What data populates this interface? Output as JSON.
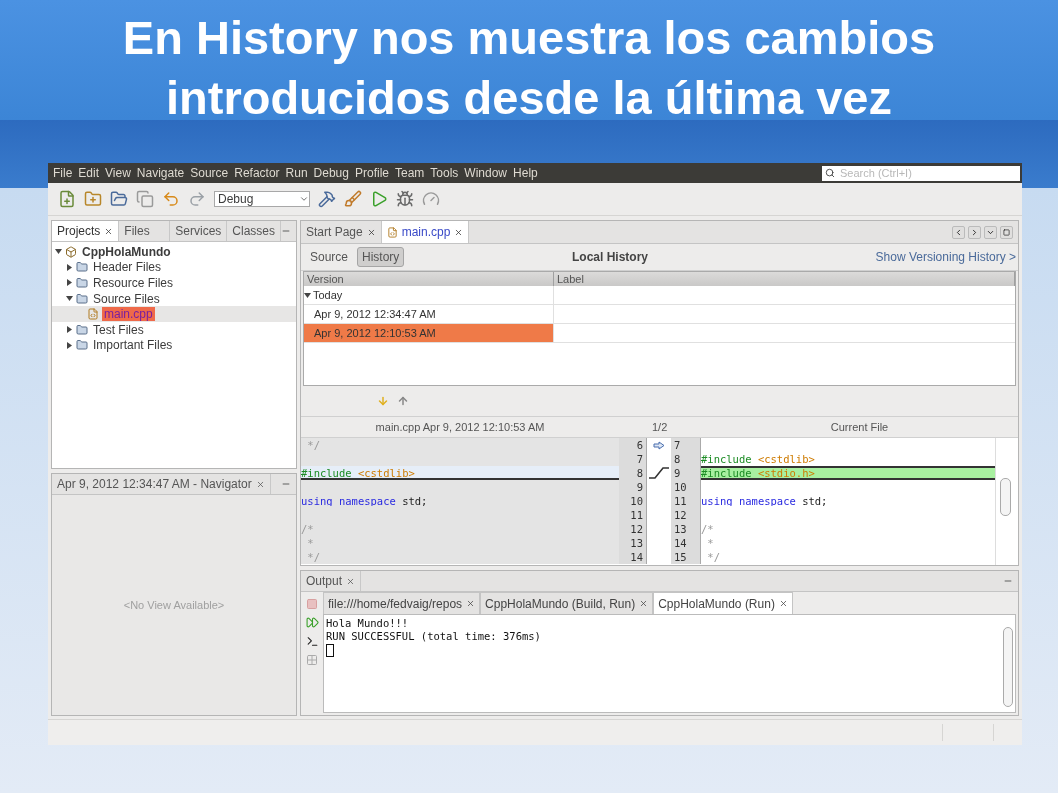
{
  "slide_title": "En History nos muestra los cambios introducidos desde la última vez",
  "menu": [
    "File",
    "Edit",
    "View",
    "Navigate",
    "Source",
    "Refactor",
    "Run",
    "Debug",
    "Profile",
    "Team",
    "Tools",
    "Window",
    "Help"
  ],
  "search": {
    "placeholder": "Search (Ctrl+I)"
  },
  "toolbar": {
    "configuration": "Debug"
  },
  "projects_panel": {
    "tabs": [
      {
        "label": "Projects",
        "selected": true,
        "closable": true
      },
      {
        "label": "Files",
        "selected": false,
        "closable": false
      },
      {
        "label": "Services",
        "selected": false,
        "closable": false
      },
      {
        "label": "Classes",
        "selected": false,
        "closable": false
      }
    ],
    "tree": [
      {
        "label": "CppHolaMundo",
        "kind": "project",
        "expanded": true,
        "selected": false,
        "children": [
          {
            "label": "Header Files",
            "kind": "folder",
            "expanded": false,
            "selected": false
          },
          {
            "label": "Resource Files",
            "kind": "folder",
            "expanded": false,
            "selected": false
          },
          {
            "label": "Source Files",
            "kind": "folder",
            "expanded": true,
            "selected": false,
            "children": [
              {
                "label": "main.cpp",
                "kind": "file",
                "selected": true
              }
            ]
          },
          {
            "label": "Test Files",
            "kind": "folder",
            "expanded": false,
            "selected": false
          },
          {
            "label": "Important Files",
            "kind": "folder",
            "expanded": false,
            "selected": false
          }
        ]
      }
    ]
  },
  "navigator": {
    "tab": "Apr 9, 2012 12:34:47 AM - Navigator",
    "empty_text": "<No View Available>"
  },
  "editor": {
    "tabs": [
      {
        "label": "Start Page",
        "selected": false
      },
      {
        "label": "main.cpp",
        "selected": true
      }
    ],
    "view_buttons": [
      {
        "label": "Source",
        "selected": false
      },
      {
        "label": "History",
        "selected": true
      }
    ],
    "title": "Local History",
    "link": "Show Versioning History >",
    "table": {
      "columns": [
        "Version",
        "Label"
      ],
      "rows": [
        {
          "version": "Today",
          "kind": "group",
          "expanded": true,
          "selected": false
        },
        {
          "version": "Apr 9, 2012 12:34:47 AM",
          "kind": "entry",
          "selected": false
        },
        {
          "version": "Apr 9, 2012 12:10:53 AM",
          "kind": "entry",
          "selected": true
        }
      ]
    },
    "diff": {
      "left_title": "main.cpp Apr 9, 2012 12:10:53 AM",
      "position": "1/2",
      "right_title": "Current File",
      "lines": [
        {
          "left_number": "6",
          "left": [
            {
              "kind": "comment",
              "text": " */"
            }
          ],
          "right_number": "7",
          "left_highlighted": false,
          "added": false,
          "current": true
        },
        {
          "left_number": "7",
          "right_number": "8",
          "right": [
            {
              "kind": "directive",
              "text": "#include"
            },
            {
              "kind": "header",
              "text": " <cstdlib>"
            }
          ],
          "left_highlighted": false,
          "added": false,
          "current": false
        },
        {
          "left_number": "8",
          "left": [
            {
              "kind": "directive",
              "text": "#include"
            },
            {
              "kind": "header",
              "text": " <cstdlib>"
            }
          ],
          "right_number": "9",
          "right": [
            {
              "kind": "directive",
              "text": "#include"
            },
            {
              "kind": "header",
              "text": " <stdio.h>"
            }
          ],
          "left_highlighted": true,
          "added": true,
          "current": false
        },
        {
          "left_number": "9",
          "right_number": "10",
          "left_highlighted": false,
          "added": false,
          "current": false
        },
        {
          "left_number": "10",
          "left": [
            {
              "kind": "keyword",
              "text": "using namespace"
            },
            {
              "kind": "plain",
              "text": " std;"
            }
          ],
          "right_number": "11",
          "right": [
            {
              "kind": "keyword",
              "text": "using namespace"
            },
            {
              "kind": "plain",
              "text": " std;"
            }
          ],
          "left_highlighted": false,
          "added": false,
          "current": false
        },
        {
          "left_number": "11",
          "right_number": "12",
          "left_highlighted": false,
          "added": false,
          "current": false
        },
        {
          "left_number": "12",
          "left": [
            {
              "kind": "comment",
              "text": "/*"
            }
          ],
          "right_number": "13",
          "right": [
            {
              "kind": "comment",
              "text": "/*"
            }
          ],
          "left_highlighted": false,
          "added": false,
          "current": false
        },
        {
          "left_number": "13",
          "left": [
            {
              "kind": "comment",
              "text": " *"
            }
          ],
          "right_number": "14",
          "right": [
            {
              "kind": "comment",
              "text": " *"
            }
          ],
          "left_highlighted": false,
          "added": false,
          "current": false
        },
        {
          "left_number": "14",
          "left": [
            {
              "kind": "comment",
              "text": " */"
            }
          ],
          "right_number": "15",
          "right": [
            {
              "kind": "comment",
              "text": " */"
            }
          ],
          "left_highlighted": false,
          "added": false,
          "current": false
        }
      ]
    }
  },
  "output": {
    "title": "Output",
    "tabs": [
      {
        "label": "file:///home/fedvaig/repos",
        "selected": false
      },
      {
        "label": "CppHolaMundo (Build, Run)",
        "selected": false
      },
      {
        "label": "CppHolaMundo (Run)",
        "selected": true
      }
    ],
    "lines": [
      "Hola Mundo!!!",
      "RUN SUCCESSFUL (total time: 376ms)"
    ]
  }
}
